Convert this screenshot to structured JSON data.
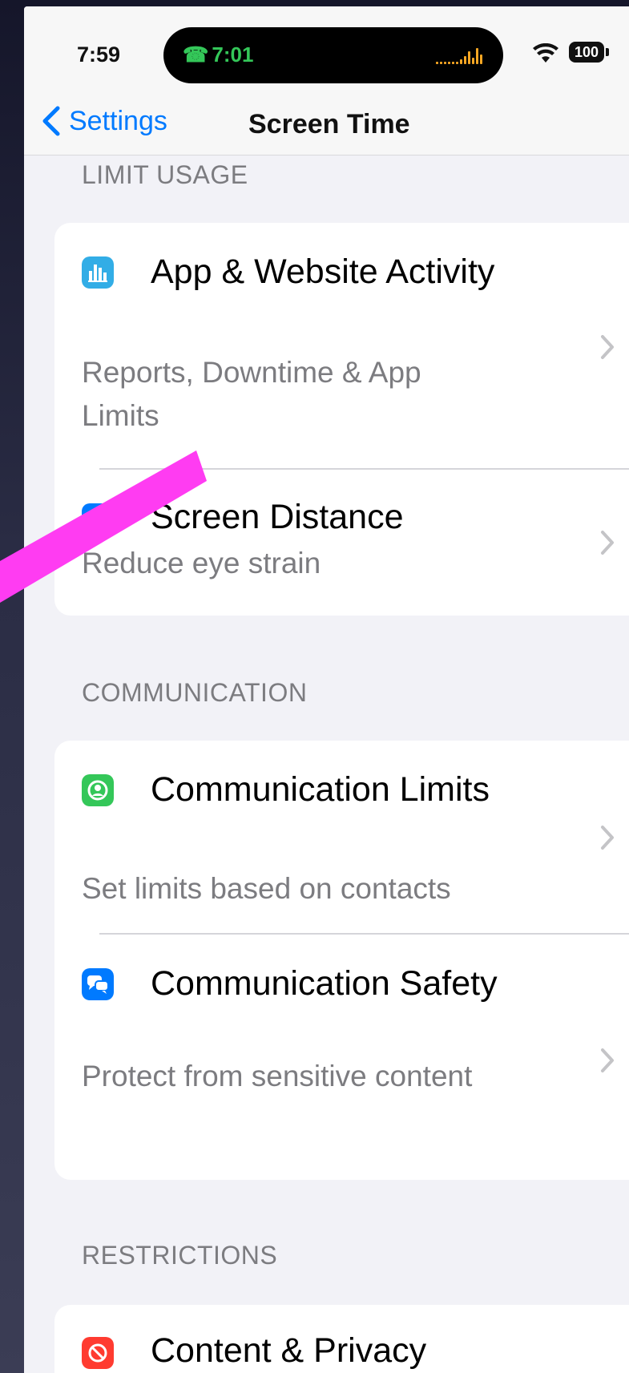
{
  "status_bar": {
    "time": "7:59",
    "call_time": "7:01",
    "battery": "100",
    "icons": [
      "phone-icon",
      "waveform-icon",
      "wifi-icon",
      "battery-icon"
    ]
  },
  "nav": {
    "back_label": "Settings",
    "title": "Screen Time"
  },
  "sections": {
    "limit_usage": {
      "header": "LIMIT USAGE",
      "items": [
        {
          "title": "App & Website Activity",
          "subtitle": "Reports, Downtime & App Limits",
          "icon": "bar-chart-icon",
          "icon_color": "#32ade6"
        },
        {
          "title": "Screen Distance",
          "subtitle": "Reduce eye strain",
          "icon": "screen-distance-icon",
          "icon_color": "#007aff"
        }
      ]
    },
    "communication": {
      "header": "COMMUNICATION",
      "items": [
        {
          "title": "Communication Limits",
          "subtitle": "Set limits based on contacts",
          "icon": "person-circle-icon",
          "icon_color": "#34c759"
        },
        {
          "title": "Communication Safety",
          "subtitle": "Protect from sensitive content",
          "icon": "chat-bubbles-icon",
          "icon_color": "#007aff"
        }
      ]
    },
    "restrictions": {
      "header": "RESTRICTIONS",
      "items": [
        {
          "title": "Content & Privacy",
          "icon": "no-entry-icon",
          "icon_color": "#ff3b30"
        }
      ]
    }
  },
  "colors": {
    "accent": "#007aff",
    "annotation": "#ff3cf2",
    "background": "#f2f2f7"
  }
}
